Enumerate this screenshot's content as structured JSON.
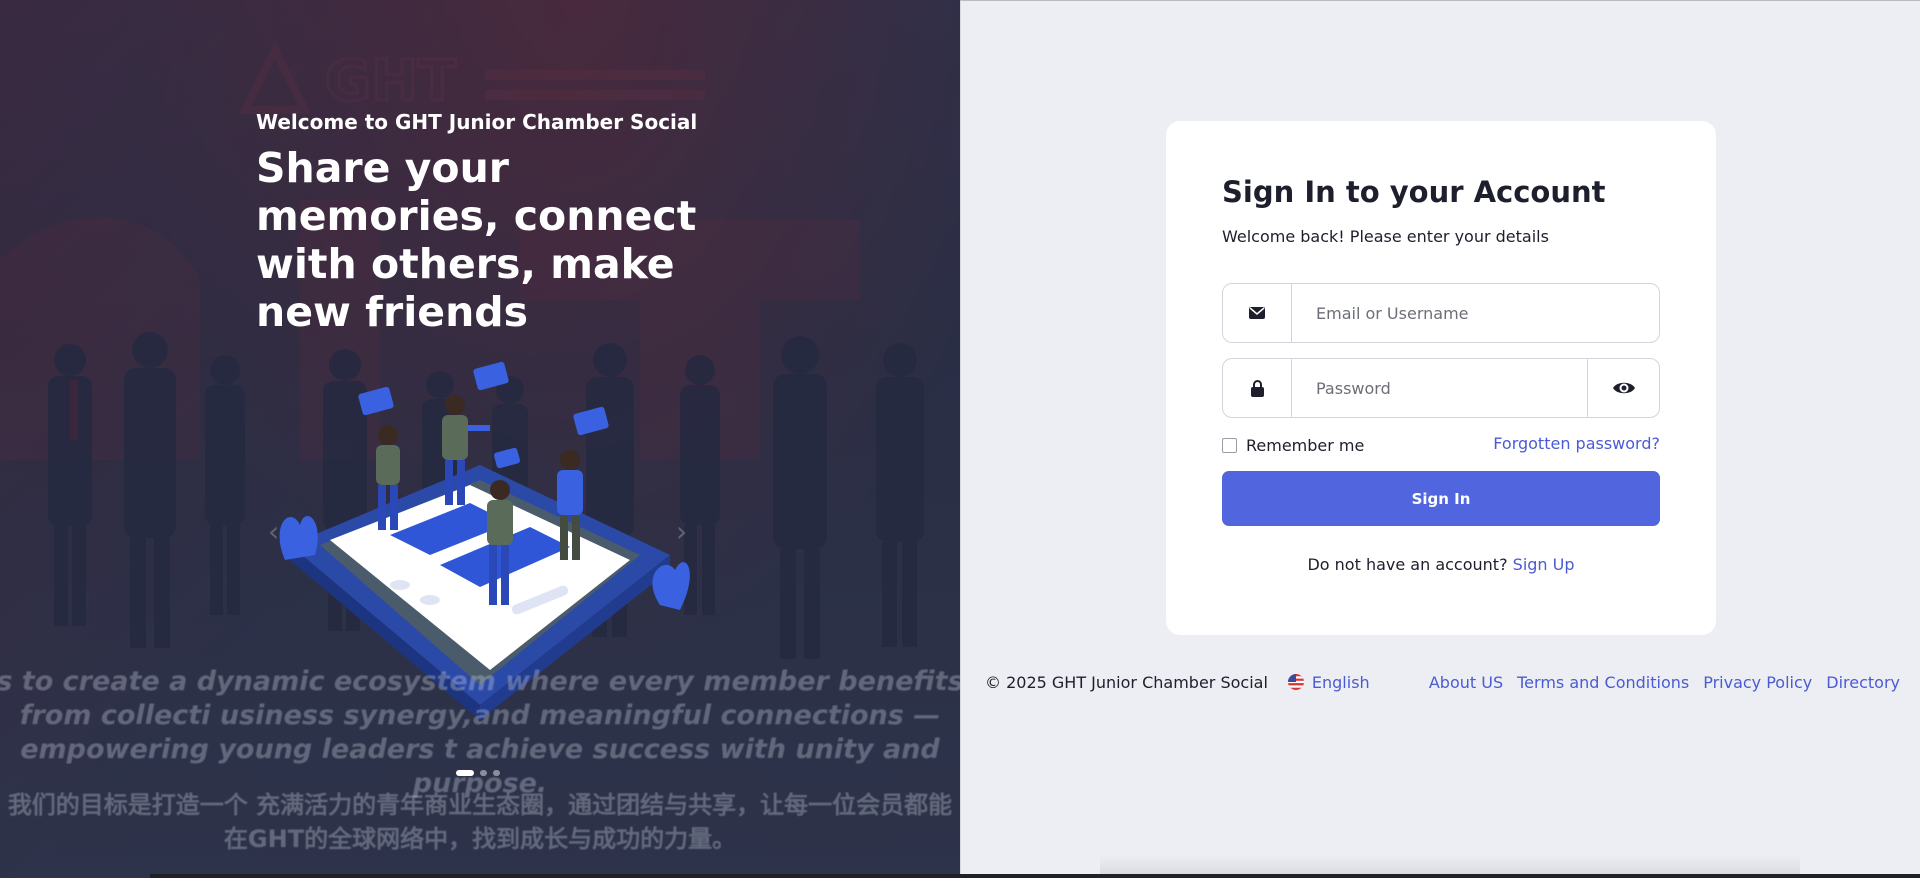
{
  "hero": {
    "welcome": "Welcome to GHT Junior Chamber Social",
    "headline": "Share your memories, connect with others, make new friends",
    "caption_en": "s to create a dynamic ecosystem where every member benefits from collecti usiness synergy,and meaningful connections — empowering young leaders t achieve success with unity and purpose.",
    "caption_zh": "我们的目标是打造一个 充满活力的青年商业生态圈，通过团结与共享，让每一位会员都能在GHT的全球网络中，找到成长与成功的力量。",
    "carousel": {
      "slides": 3,
      "active": 1
    }
  },
  "login": {
    "title": "Sign In to your Account",
    "subtitle": "Welcome back! Please enter your details",
    "email": {
      "placeholder": "Email or Username",
      "value": "",
      "icon": "envelope-icon"
    },
    "password": {
      "placeholder": "Password",
      "value": "",
      "icon": "lock-icon",
      "toggle_icon": "eye-icon"
    },
    "remember_label": "Remember me",
    "remember_checked": false,
    "forgot_label": "Forgotten password?",
    "signin_label": "Sign In",
    "signup_prompt": "Do not have an account?",
    "signup_label": "Sign Up"
  },
  "footer": {
    "copyright": "© 2025 GHT Junior Chamber Social",
    "language": "English",
    "links": [
      "About US",
      "Terms and Conditions",
      "Privacy Policy",
      "Directory"
    ]
  },
  "colors": {
    "accent": "#5065de",
    "link": "#4a5bd4",
    "panel_bg": "#eceef3",
    "hero_bg": "#34384f"
  }
}
